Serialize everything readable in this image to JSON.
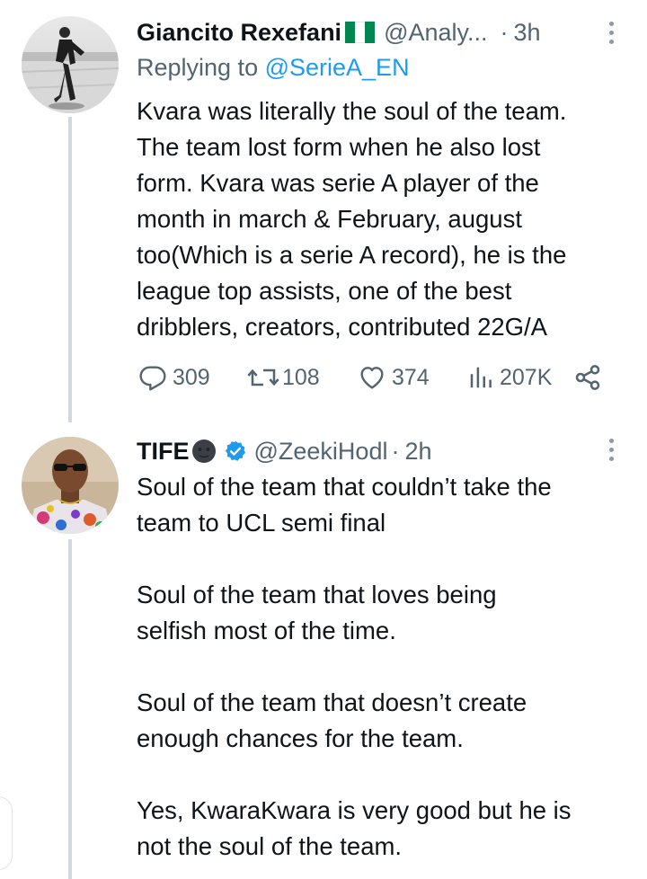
{
  "tweet1": {
    "name": "Giancito Rexefani",
    "handle": "@Analy...",
    "dot": "·",
    "time": "3h",
    "replying_prefix": "Replying to ",
    "replying_to": "@SerieA_EN",
    "text": "Kvara was literally the soul of the team.\nThe team lost form when he also lost\nform. Kvara was serie A player of the\nmonth in march & February, august\ntoo(Which is a serie A record), he is the\nleague top assists, one of the best\ndribblers, creators, contributed 22G/A",
    "flag_colors": [
      "#008751",
      "#ffffff",
      "#008751"
    ],
    "actions": {
      "replies": "309",
      "retweets": "108",
      "likes": "374",
      "views": "207K"
    }
  },
  "tweet2": {
    "name": "TIFE",
    "handle": "@ZeekiHodl",
    "dot": "·",
    "time": "2h",
    "text": "Soul of the team that couldn’t take the\nteam to UCL semi final\n\nSoul of the team that loves being\nselfish most of the time.\n\nSoul of the team that doesn’t create\nenough chances for the team.\n\nYes, KwaraKwara is very good but he is\nnot the soul of the team.",
    "verified_color": "#1d9bf0"
  },
  "icons": [
    "more-icon",
    "reply-icon",
    "retweet-icon",
    "like-icon",
    "views-icon",
    "share-icon",
    "verified-icon"
  ]
}
